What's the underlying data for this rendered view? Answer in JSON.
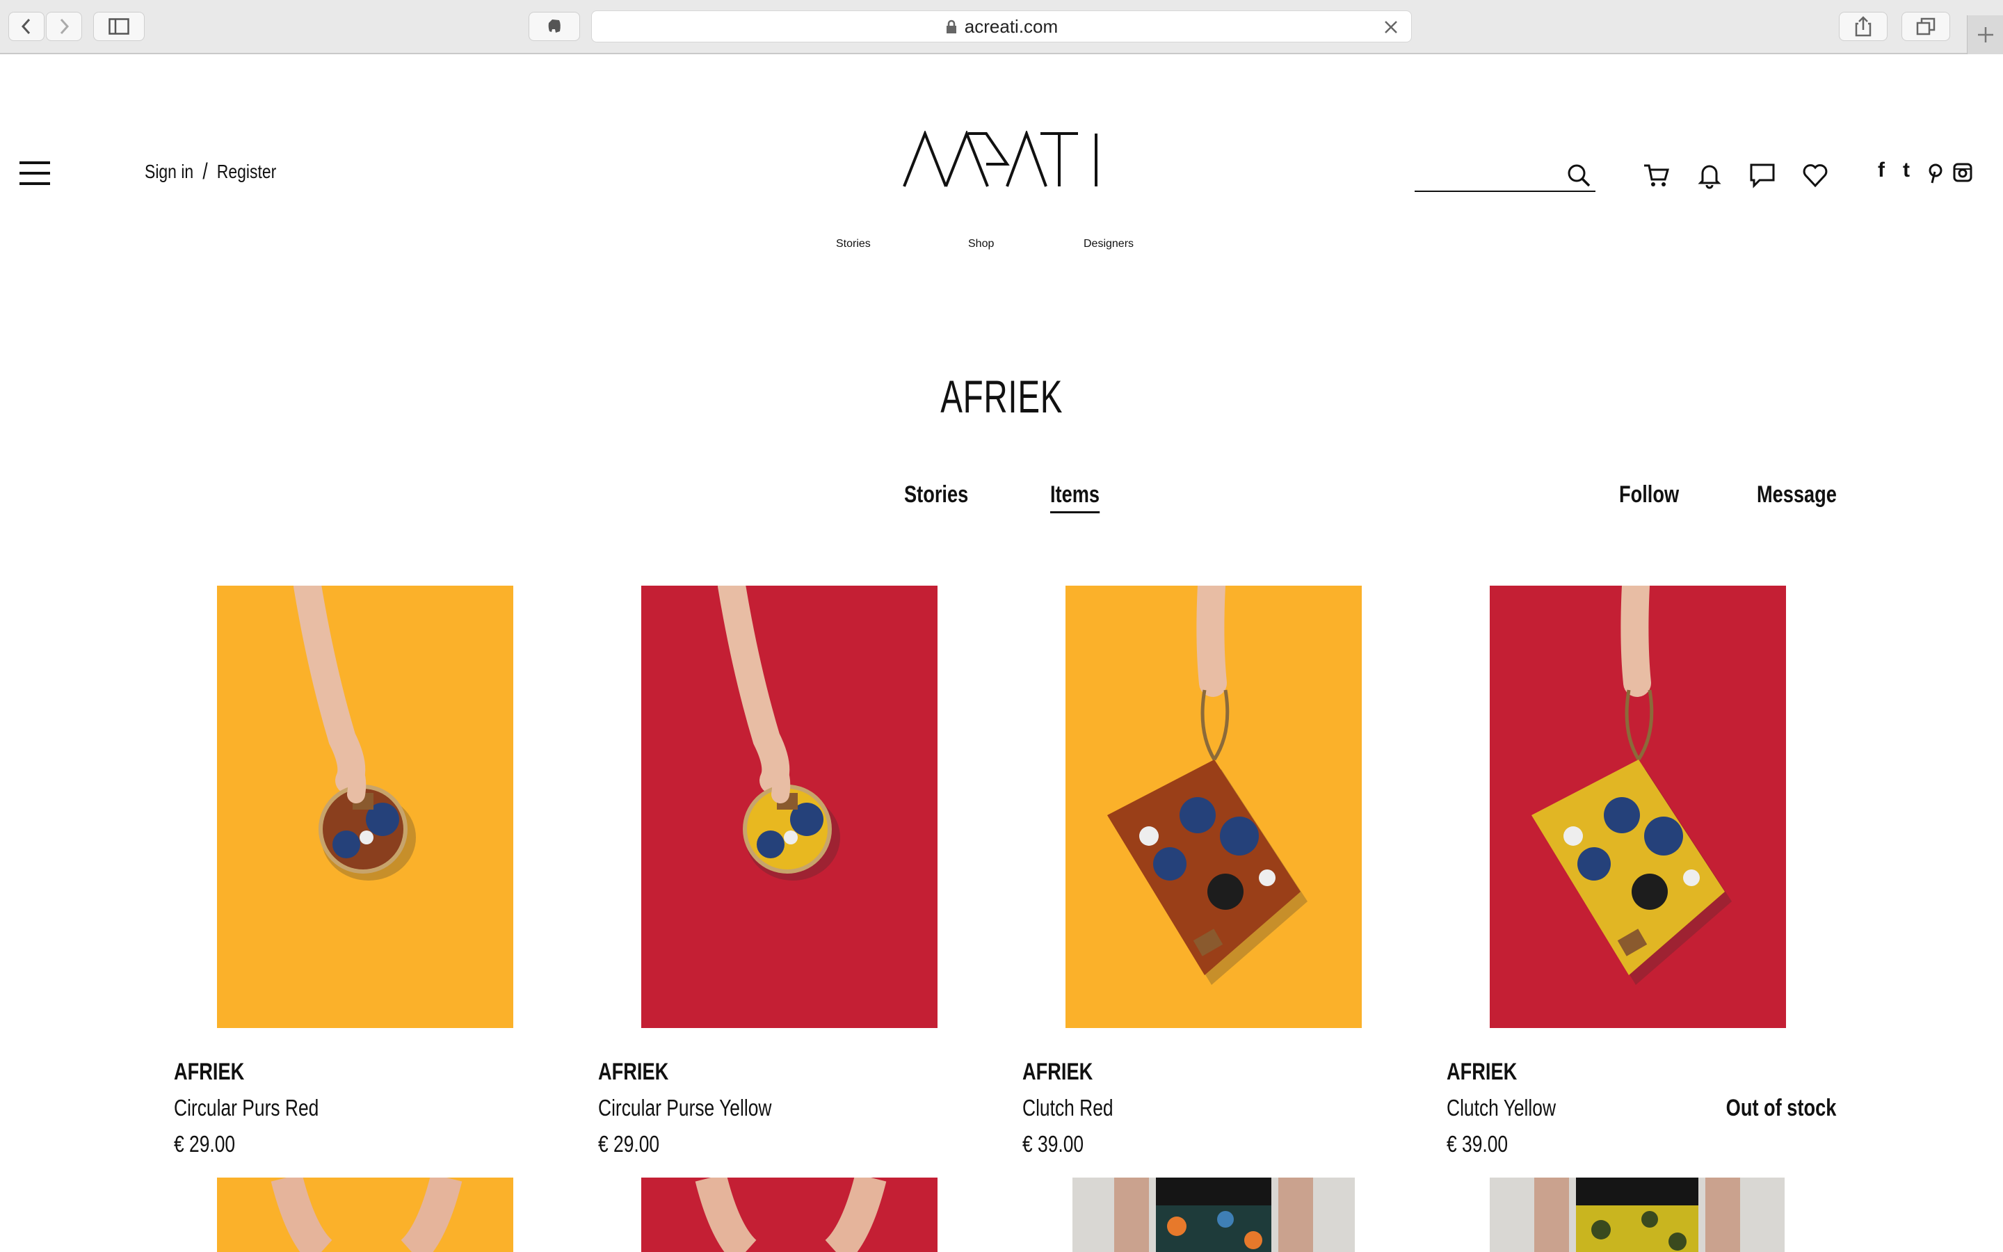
{
  "browser": {
    "url": "acreati.com"
  },
  "header": {
    "sign_in": "Sign in",
    "separator": "/",
    "register": "Register",
    "search_placeholder": "",
    "social": [
      "f",
      "t"
    ]
  },
  "main_nav": [
    "Stories",
    "Shop",
    "Designers"
  ],
  "designer": {
    "title": "AFRIEK",
    "tabs": [
      {
        "label": "Stories",
        "active": false
      },
      {
        "label": "Items",
        "active": true
      }
    ],
    "actions": {
      "follow": "Follow",
      "message": "Message"
    }
  },
  "products": [
    {
      "brand": "AFRIEK",
      "name": "Circular Purs Red",
      "price": "€ 29.00",
      "status": "",
      "bg_color": "#fbb12a",
      "bag_color": "#8a3f1e"
    },
    {
      "brand": "AFRIEK",
      "name": "Circular Purse Yellow",
      "price": "€ 29.00",
      "status": "",
      "bg_color": "#c41f34",
      "bag_color": "#e8b820"
    },
    {
      "brand": "AFRIEK",
      "name": "Clutch Red",
      "price": "€ 39.00",
      "status": "",
      "bg_color": "#fbb12a",
      "bag_color": "#9a3f18"
    },
    {
      "brand": "AFRIEK",
      "name": "Clutch Yellow",
      "price": "€ 39.00",
      "status": "Out of stock",
      "bg_color": "#c41f34",
      "bag_color": "#e1b624"
    }
  ],
  "colors": {
    "text": "#111111",
    "chrome_bg": "#e9e9e9",
    "accent_yellow": "#fbb12a",
    "accent_red": "#c41f34"
  }
}
